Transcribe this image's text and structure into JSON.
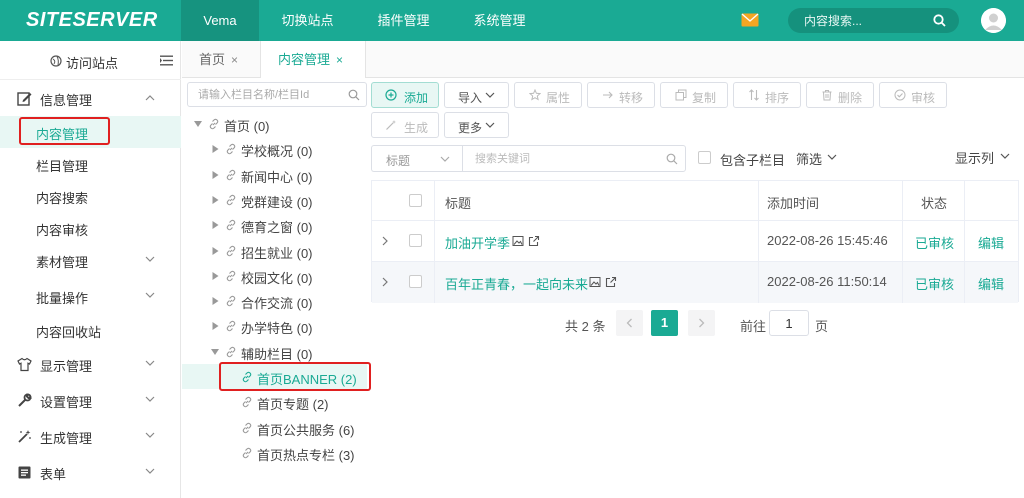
{
  "brand": {
    "logo_text": "SITESERVER",
    "accent": "#1aaa94",
    "highlight": "#e02020"
  },
  "topnav": {
    "items": [
      {
        "label": "Vema",
        "active": true
      },
      {
        "label": "切换站点"
      },
      {
        "label": "插件管理"
      },
      {
        "label": "系统管理"
      }
    ],
    "search_placeholder": "内容搜索...",
    "icons": [
      "mail-icon",
      "search-icon",
      "avatar-icon"
    ]
  },
  "sidebar": {
    "visit_site": "访问站点",
    "groups": [
      {
        "label": "信息管理",
        "icon": "edit-icon",
        "expanded": true,
        "items": [
          {
            "label": "内容管理",
            "active": true
          },
          {
            "label": "栏目管理"
          },
          {
            "label": "内容搜索"
          },
          {
            "label": "内容审核"
          },
          {
            "label": "素材管理",
            "has_children": true
          },
          {
            "label": "批量操作",
            "has_children": true
          },
          {
            "label": "内容回收站"
          }
        ]
      },
      {
        "label": "显示管理",
        "icon": "shirt-icon"
      },
      {
        "label": "设置管理",
        "icon": "wrench-icon"
      },
      {
        "label": "生成管理",
        "icon": "magic-wand-icon"
      },
      {
        "label": "表单",
        "icon": "form-icon"
      }
    ]
  },
  "tabs": [
    {
      "label": "首页",
      "close": "×"
    },
    {
      "label": "内容管理",
      "close": "×",
      "active": true
    }
  ],
  "tree": {
    "search_placeholder": "请输入栏目名称/栏目Id",
    "nodes": [
      {
        "label": "首页 (0)",
        "level": 0,
        "expanded": true
      },
      {
        "label": "学校概况 (0)",
        "level": 1
      },
      {
        "label": "新闻中心 (0)",
        "level": 1
      },
      {
        "label": "党群建设 (0)",
        "level": 1
      },
      {
        "label": "德育之窗 (0)",
        "level": 1
      },
      {
        "label": "招生就业 (0)",
        "level": 1
      },
      {
        "label": "校园文化 (0)",
        "level": 1
      },
      {
        "label": "合作交流 (0)",
        "level": 1
      },
      {
        "label": "办学特色 (0)",
        "level": 1
      },
      {
        "label": "辅助栏目 (0)",
        "level": 1,
        "expanded": true
      },
      {
        "label": "首页BANNER (2)",
        "level": 2,
        "active": true
      },
      {
        "label": "首页专题 (2)",
        "level": 2
      },
      {
        "label": "首页公共服务 (6)",
        "level": 2
      },
      {
        "label": "首页热点专栏 (3)",
        "level": 2
      }
    ]
  },
  "toolbar": {
    "add": "添加",
    "import": "导入",
    "attributes": "属性",
    "transfer": "转移",
    "copy": "复制",
    "sort": "排序",
    "delete": "删除",
    "review": "审核",
    "generate": "生成",
    "more": "更多"
  },
  "filter": {
    "field_select": "标题",
    "keyword_placeholder": "搜索关键词",
    "include_sub": "包含子栏目",
    "filter_label": "筛选",
    "columns_label": "显示列"
  },
  "table": {
    "columns": [
      "标题",
      "添加时间",
      "状态"
    ],
    "rows": [
      {
        "title": "加油开学季",
        "time": "2022-08-26 15:45:46",
        "status": "已审核",
        "action": "编辑"
      },
      {
        "title": "百年正青春，一起向未来",
        "time": "2022-08-26 11:50:14",
        "status": "已审核",
        "action": "编辑"
      }
    ]
  },
  "pagination": {
    "total_text": "共 2 条",
    "current_page": "1",
    "goto_label": "前往",
    "goto_value": "1",
    "page_suffix": "页"
  }
}
